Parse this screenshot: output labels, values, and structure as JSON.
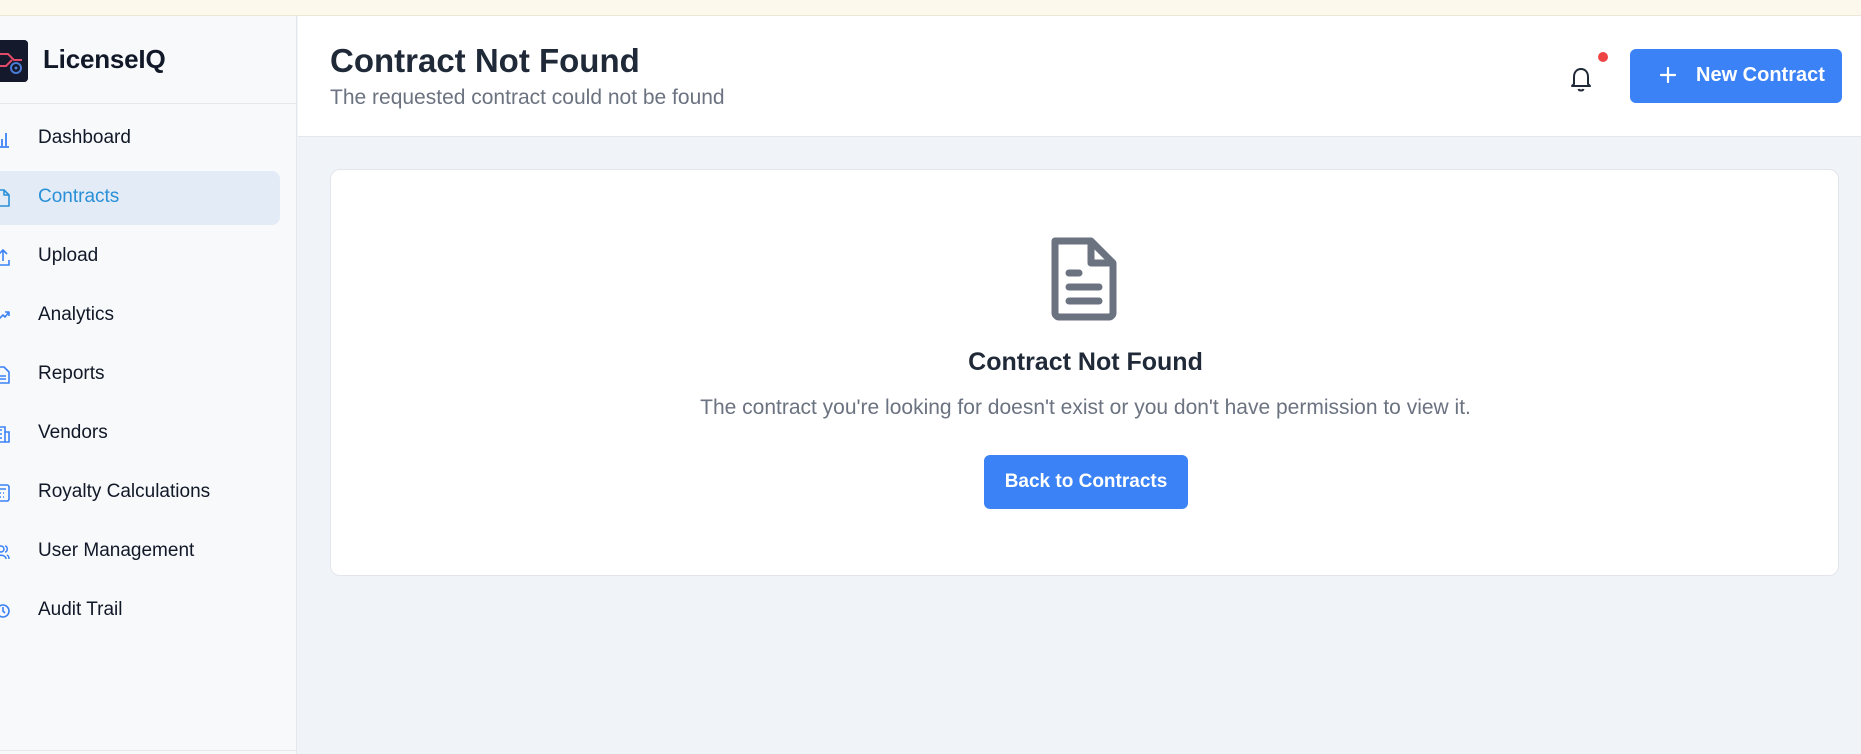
{
  "app": {
    "name": "LicenseIQ"
  },
  "sidebar": {
    "items": [
      {
        "label": "Dashboard",
        "icon": "bar-chart-icon",
        "active": false
      },
      {
        "label": "Contracts",
        "icon": "file-icon",
        "active": true
      },
      {
        "label": "Upload",
        "icon": "upload-icon",
        "active": false
      },
      {
        "label": "Analytics",
        "icon": "trending-up-icon",
        "active": false
      },
      {
        "label": "Reports",
        "icon": "file-text-icon",
        "active": false
      },
      {
        "label": "Vendors",
        "icon": "building-icon",
        "active": false
      },
      {
        "label": "Royalty Calculations",
        "icon": "calculator-icon",
        "active": false
      },
      {
        "label": "User Management",
        "icon": "users-icon",
        "active": false
      },
      {
        "label": "Audit Trail",
        "icon": "clock-icon",
        "active": false
      }
    ]
  },
  "header": {
    "title": "Contract Not Found",
    "subtitle": "The requested contract could not be found",
    "new_button_label": "New Contract",
    "notification_icon": "bell-icon",
    "has_notification": true
  },
  "empty_state": {
    "icon": "document-icon",
    "title": "Contract Not Found",
    "message": "The contract you're looking for doesn't exist or you don't have permission to view it.",
    "button_label": "Back to Contracts"
  },
  "colors": {
    "accent": "#3b82f6",
    "active_nav_bg": "#e3ebf6",
    "active_nav_text": "#2990d8",
    "notification_dot": "#ef4444"
  }
}
